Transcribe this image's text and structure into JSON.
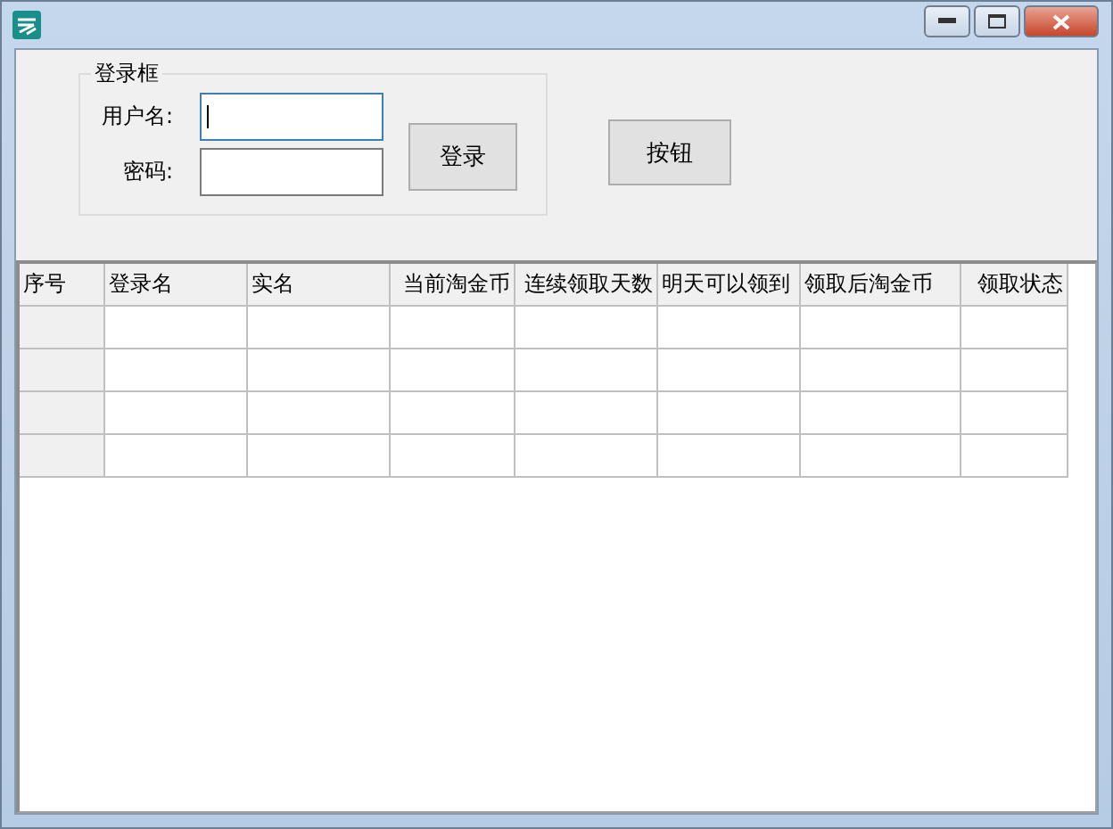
{
  "login_group": {
    "title": "登录框",
    "fields": [
      {
        "label": "用户名:",
        "focused": true
      },
      {
        "label": "密码:",
        "focused": false
      }
    ],
    "button": "登录"
  },
  "button": "按钮",
  "table": {
    "columns": [
      "序号",
      "登录名",
      "实名",
      "当前淘金币",
      "连续领取天数",
      "明天可以领到",
      "领取后淘金币",
      "领取状态"
    ]
  }
}
